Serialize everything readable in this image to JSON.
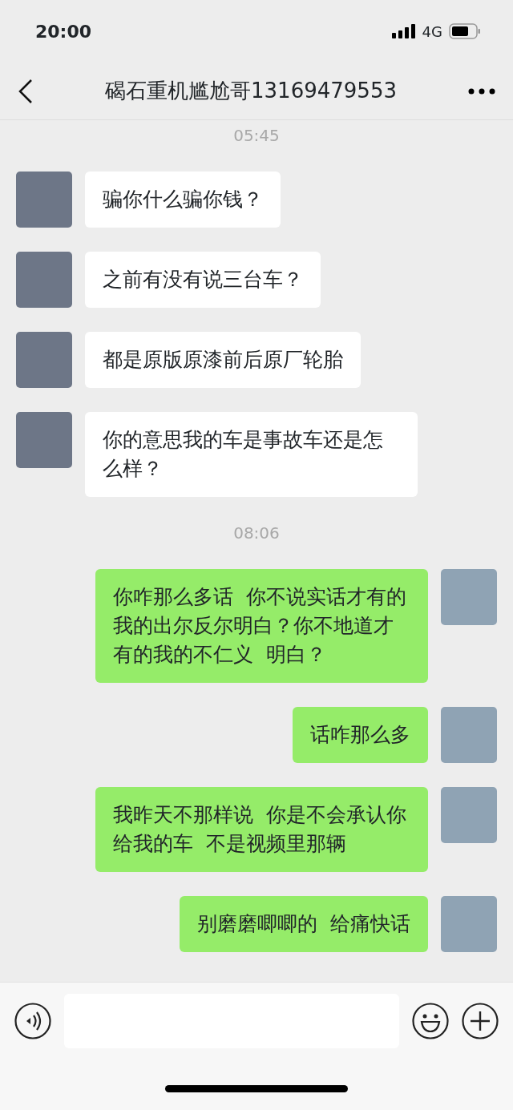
{
  "status_bar": {
    "time": "20:00",
    "network": "4G"
  },
  "header": {
    "title": "碣石重机尴尬哥13169479553"
  },
  "messages": [
    {
      "kind": "time",
      "text": "05:45"
    },
    {
      "kind": "message",
      "outgoing": false,
      "text": "骗你什么骗你钱？"
    },
    {
      "kind": "message",
      "outgoing": false,
      "text": "之前有没有说三台车？"
    },
    {
      "kind": "message",
      "outgoing": false,
      "text": "都是原版原漆前后原厂轮胎"
    },
    {
      "kind": "message",
      "outgoing": false,
      "text": "你的意思我的车是事故车还是怎么样？"
    },
    {
      "kind": "time",
      "text": "08:06"
    },
    {
      "kind": "message",
      "outgoing": true,
      "text": "你咋那么多话  你不说实话才有的我的出尔反尔明白？你不地道才有的我的不仁义  明白？"
    },
    {
      "kind": "message",
      "outgoing": true,
      "text": "话咋那么多"
    },
    {
      "kind": "message",
      "outgoing": true,
      "text": "我昨天不那样说  你是不会承认你给我的车  不是视频里那辆"
    },
    {
      "kind": "message",
      "outgoing": true,
      "text": "别磨磨唧唧的  给痛快话"
    }
  ]
}
